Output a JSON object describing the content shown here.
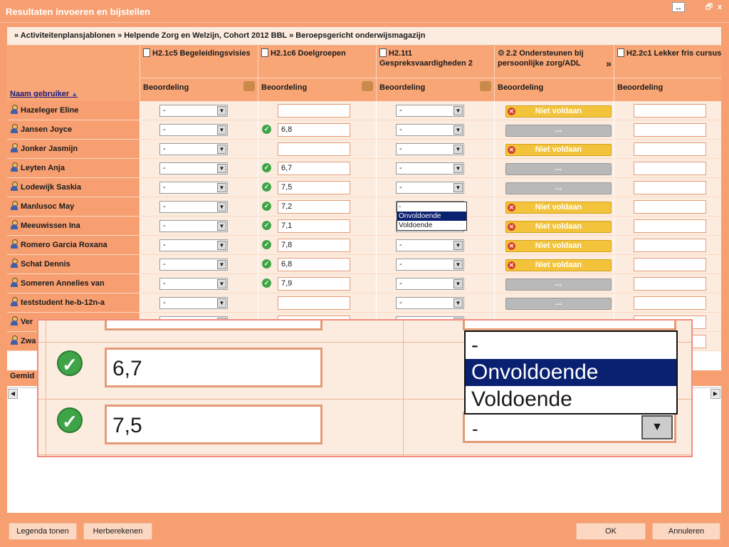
{
  "window": {
    "title": "Resultaten invoeren en bijstellen",
    "resize_glyph": "↔",
    "restore_glyph": "🗗",
    "close_glyph": "x"
  },
  "breadcrumb": "» Activiteitenplansjablonen » Helpende Zorg en Welzijn, Cohort 2012 BBL » Beroepsgericht onderwijsmagazijn",
  "grid": {
    "name_header": "Naam gebruiker",
    "sort_glyph": "▲",
    "columns": [
      {
        "title": "H2.1c5 Begeleidingsvisies",
        "sub": "Beoordeling"
      },
      {
        "title": "H2.1c6 Doelgroepen",
        "sub": "Beoordeling"
      },
      {
        "title": "H2.1t1 Gespreksvaardigheden 2",
        "sub": "Beoordeling"
      },
      {
        "title": "2.2 Ondersteunen bij persoonlijke zorg/ADL",
        "sub": "Beoordeling",
        "more": "»"
      },
      {
        "title": "H2.2c1 Lekker fris cursus",
        "sub": "Beoordeling"
      }
    ],
    "select_default": "-",
    "niet_voldaan": "Niet voldaan",
    "dots": "...",
    "rows": [
      {
        "name": "Hazeleger Eline",
        "c2": "",
        "c2check": false,
        "c4": "nv"
      },
      {
        "name": "Jansen Joyce",
        "c2": "6,8",
        "c2check": true,
        "c4": "dots"
      },
      {
        "name": "Jonker Jasmijn",
        "c2": "",
        "c2check": false,
        "c4": "nv"
      },
      {
        "name": "Leyten Anja",
        "c2": "6,7",
        "c2check": true,
        "c4": "dots"
      },
      {
        "name": "Lodewijk Saskia",
        "c2": "7,5",
        "c2check": true,
        "c4": "dots"
      },
      {
        "name": "Manlusoc May",
        "c2": "7,2",
        "c2check": true,
        "c4": "nv"
      },
      {
        "name": "Meeuwissen Ina",
        "c2": "7,1",
        "c2check": true,
        "c4": "nv"
      },
      {
        "name": "Romero Garcia Roxana",
        "c2": "7,8",
        "c2check": true,
        "c4": "nv"
      },
      {
        "name": "Schat Dennis",
        "c2": "6,8",
        "c2check": true,
        "c4": "nv"
      },
      {
        "name": "Someren Annelies van",
        "c2": "7,9",
        "c2check": true,
        "c4": "dots"
      },
      {
        "name": "teststudent he-b-12n-a",
        "c2": "",
        "c2check": false,
        "c4": "dots"
      },
      {
        "name": "Ver",
        "c2": "",
        "c2check": false,
        "c4": "none"
      },
      {
        "name": "Zwa",
        "c2": "",
        "c2check": false,
        "c4": "none"
      }
    ],
    "avg_label": "Gemid",
    "dropdown_options": [
      "-",
      "Onvoldoende",
      "Voldoende"
    ]
  },
  "magnifier": {
    "value1": "6,7",
    "value2": "7,5",
    "options": [
      "-",
      "Onvoldoende",
      "Voldoende"
    ],
    "select_value": "-"
  },
  "footer": {
    "legend": "Legenda tonen",
    "recalc": "Herberekenen",
    "ok": "OK",
    "cancel": "Annuleren"
  },
  "colors": {
    "accent": "#f79f71",
    "highlight": "#0a2070",
    "warning": "#f3c43b",
    "success": "#3fa447"
  }
}
